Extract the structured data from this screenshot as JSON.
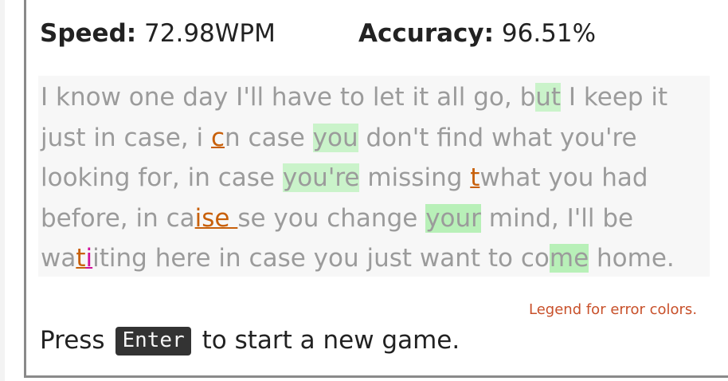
{
  "stats": {
    "speed_label": "Speed:",
    "speed_value": "72.98WPM",
    "accuracy_label": "Accuracy:",
    "accuracy_value": "96.51%"
  },
  "passage": {
    "lines": [
      [
        {
          "t": "I know one day I'll have to let it all go, b",
          "s": ""
        },
        {
          "t": "ut",
          "s": "g2"
        },
        {
          "t": " I keep it",
          "s": ""
        }
      ],
      [
        {
          "t": "just in case, i ",
          "s": ""
        },
        {
          "t": "c",
          "s": "err-orange"
        },
        {
          "t": "n case ",
          "s": ""
        },
        {
          "t": "you",
          "s": "g2"
        },
        {
          "t": " don't find what you're",
          "s": ""
        }
      ],
      [
        {
          "t": "looking for, in case ",
          "s": ""
        },
        {
          "t": "you're",
          "s": "g2"
        },
        {
          "t": " missing ",
          "s": ""
        },
        {
          "t": "t",
          "s": "err-orange"
        },
        {
          "t": "what you had",
          "s": ""
        }
      ],
      [
        {
          "t": "before, in ca",
          "s": ""
        },
        {
          "t": "ise ",
          "s": "err-orange"
        },
        {
          "t": "se you change ",
          "s": ""
        },
        {
          "t": "your",
          "s": "g3"
        },
        {
          "t": " mind, I'll be",
          "s": ""
        }
      ],
      [
        {
          "t": "wa",
          "s": ""
        },
        {
          "t": "t",
          "s": "err-orange"
        },
        {
          "t": "i",
          "s": "err-magenta"
        },
        {
          "t": "iting here in case you just want to co",
          "s": ""
        },
        {
          "t": "me",
          "s": "g3"
        },
        {
          "t": " home.",
          "s": ""
        }
      ]
    ]
  },
  "legend_link": "Legend for error colors.",
  "prompt": {
    "before": "Press",
    "key": "Enter",
    "after": "to start a new game."
  },
  "colors": {
    "error_orange": "#c8600a",
    "error_magenta": "#d0109a",
    "correct_green": "#caf3ca",
    "slow_pink": "#f2dcf2"
  }
}
